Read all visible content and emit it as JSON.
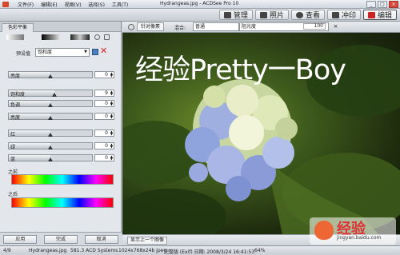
{
  "window": {
    "menu": [
      "文件(F)",
      "编辑(E)",
      "视图(V)",
      "选择(S)",
      "工具(T)"
    ],
    "title": "Hydrangeas.jpg - ACDSee Pro 10",
    "controls": [
      "_",
      "□",
      "×"
    ]
  },
  "modes": [
    {
      "label": "管理",
      "icon": "grid-icon",
      "active": false
    },
    {
      "label": "照片",
      "icon": "photo-icon",
      "active": false
    },
    {
      "label": "查看",
      "icon": "eye-icon",
      "active": false
    },
    {
      "label": "冲印",
      "icon": "develop-icon",
      "active": false
    },
    {
      "label": "编辑",
      "icon": "edit-icon",
      "active": true
    }
  ],
  "left_panel": {
    "tab": "色彩平衡",
    "preset_label": "预设值",
    "preset_value": "饱和度",
    "sliders": [
      {
        "label": "亮度",
        "value": "0",
        "fraction": 0.5
      },
      {
        "label": "饱和度",
        "value": "9",
        "fraction": 0.55
      },
      {
        "label": "色调",
        "value": "0",
        "fraction": 0.5
      },
      {
        "label": "亮度",
        "value": "0",
        "fraction": 0.5
      },
      {
        "label": "红",
        "value": "0",
        "fraction": 0.5
      },
      {
        "label": "绿",
        "value": "0",
        "fraction": 0.5
      },
      {
        "label": "蓝",
        "value": "0",
        "fraction": 0.5
      }
    ],
    "before_label": "之前",
    "after_label": "之后",
    "buttons": [
      "应用",
      "完成",
      "取消"
    ]
  },
  "viewer": {
    "toolbar": {
      "button": "针对像素",
      "blend_label": "混合:",
      "blend_value": "普通",
      "opacity_label": "阻光度",
      "opacity_value": "100"
    },
    "overlay_text": "经验Pretty一Boy",
    "status_button": "显示上一个图像"
  },
  "status": {
    "index": "4/9",
    "file": "Hydrangeas.jpg",
    "size": "581.3 ACD Systems",
    "dims": "1024x768x24b jpeg",
    "date": "完整版 (Exif) 日期: 2008/3/24 16:41:53",
    "zoom": "64%"
  },
  "watermark": {
    "main": "经验",
    "sub": "jingyan.baidu.com"
  },
  "colors": {
    "accent": "#d9472b",
    "close": "#d54a3a"
  }
}
